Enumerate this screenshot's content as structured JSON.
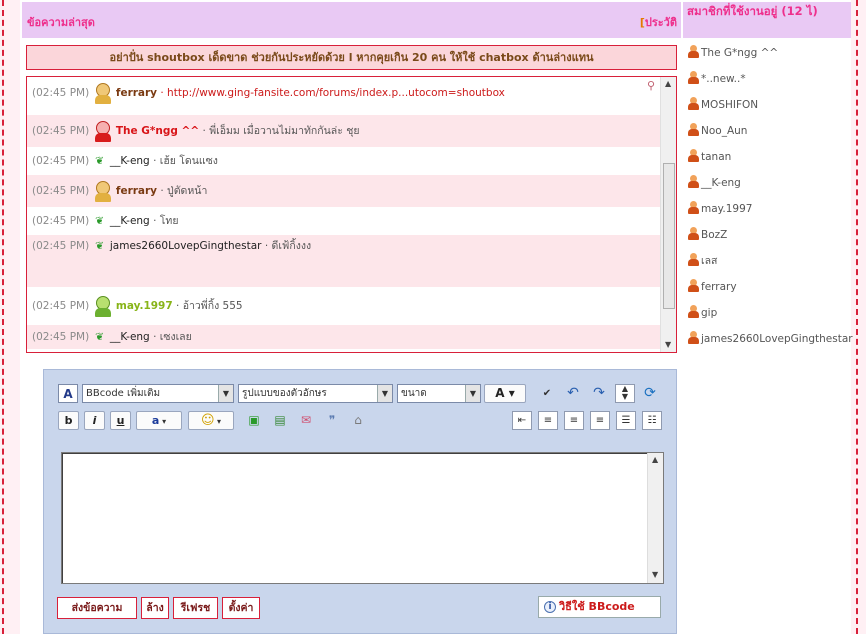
{
  "main_header": {
    "title": "ข้อความล่าสุด",
    "history_bracket": "[",
    "history_label": "ประวัติ"
  },
  "notice": "อย่าปั่น shoutbox เด็ดขาด ช่วยกันประหยัดด้วย l หากคุยเกิน 20 คน ให้ใช้ chatbox ด้านล่างแทน",
  "messages": [
    {
      "time": "(02:45 PM)",
      "user": "ferrary",
      "text": "· http://www.ging-fansite.com/forums/index.p...utocom=shoutbox",
      "avatar": "girl-avatar-icon",
      "style": "brown"
    },
    {
      "time": "(02:45 PM)",
      "user": "The G*ngg ^^",
      "text": "· พี่เอ็มม เมื่อวานไม่มาทักกันล่ะ ชุย",
      "avatar": "red-girl-avatar-icon",
      "style": "red"
    },
    {
      "time": "(02:45 PM)",
      "user": "__K-eng",
      "text": "· เฮ้ย โดนแซง",
      "avatar": "sprout-icon",
      "style": "plain"
    },
    {
      "time": "(02:45 PM)",
      "user": "ferrary",
      "text": "· ปู่ตัดหน้า",
      "avatar": "girl-avatar-icon",
      "style": "brown"
    },
    {
      "time": "(02:45 PM)",
      "user": "__K-eng",
      "text": "· โทย",
      "avatar": "sprout-icon",
      "style": "plain"
    },
    {
      "time": "(02:45 PM)",
      "user": "james2660LovepGingthestar",
      "text": "· ดีเฟ้กิ้งงง",
      "avatar": "sprout-icon",
      "style": "plain"
    },
    {
      "time": "(02:45 PM)",
      "user": "may.1997",
      "text": "· อ้าวพี่กิ้ง 555",
      "avatar": "green-girl-avatar-icon",
      "style": "lime"
    },
    {
      "time": "(02:45 PM)",
      "user": "__K-eng",
      "text": "· เซงเลย",
      "avatar": "sprout-icon",
      "style": "plain"
    }
  ],
  "sidebar": {
    "title": "สมาชิกที่ใช้งานอยู่ (12 ไ)",
    "users": [
      "The G*ngg ^^",
      "*..new..*",
      "MOSHIFON",
      "Noo_Aun",
      "tanan",
      "__K-eng",
      "may.1997",
      "BozZ",
      "เลส",
      "ferrary",
      "gip",
      "james2660LovepGingthestar"
    ]
  },
  "editor": {
    "bbcode_select": "BBcode เพิ่มเติม",
    "font_select": "รูปแบบของตัวอักษร",
    "size_select": "ขนาด",
    "color_label": "A",
    "bold": "b",
    "italic": "i",
    "underline": "u",
    "text_color": "a",
    "smile": "☺",
    "textarea_value": ""
  },
  "buttons": {
    "send": "ส่งข้อความ",
    "clear": "ล้าง",
    "refresh": "รีเฟรช",
    "settings": "ตั้งค่า",
    "bbcode_help": "วิธีใช้ BBcode"
  },
  "colors": {
    "accent": "#d8203a",
    "header_bg": "#e9c9f4",
    "header_text": "#ee2f8c",
    "editor_bg": "#c9d6ec"
  }
}
